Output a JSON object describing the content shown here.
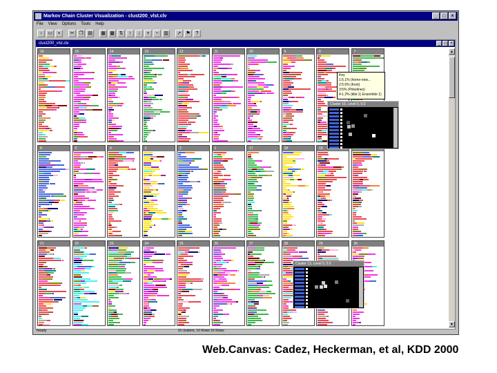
{
  "window": {
    "title": "Markov Chain Cluster Visualization - clust200_vlst.clv",
    "minimize": "_",
    "maximize": "□",
    "close": "×"
  },
  "menu": [
    "File",
    "View",
    "Options",
    "Tools",
    "Help"
  ],
  "mdi": {
    "title": "clust200_vlst.clv"
  },
  "tooltip": {
    "lines": [
      "Key",
      "1:5.1% (home-new...",
      "2:5.6% (front)",
      "3:5% (Pirkelines)",
      "4:1.2% (title:1) Ensemble 1)"
    ]
  },
  "popups": [
    {
      "title": "Cluster 16, Level 0, 0.0"
    },
    {
      "title": "Cluster 13, Level 0, 0.0"
    }
  ],
  "status": {
    "left": "Ready",
    "right": "16 clusters, 10 Rows  16 Rows"
  },
  "caption": "Web.Canvas: Cadez, Heckerman, et al, KDD 2000",
  "colors": {
    "title_blue": "#000080",
    "palette": [
      "#e8464e",
      "#3cb44b",
      "#f032e6",
      "#4363d8",
      "#46f0f0",
      "#f58231",
      "#ffe119",
      "#911eb4",
      "#9a6324",
      "#a9a9a9",
      "#808000",
      "#ffb3d9",
      "#008080",
      "#800000",
      "#000075"
    ]
  },
  "clusters": [
    {
      "label": "16",
      "dominant": "#e8464e"
    },
    {
      "label": "15",
      "dominant": "#f032e6"
    },
    {
      "label": "14",
      "dominant": "#f032e6"
    },
    {
      "label": "13",
      "dominant": "#3cb44b"
    },
    {
      "label": "12",
      "dominant": "#e8464e"
    },
    {
      "label": "11",
      "dominant": "#f032e6"
    },
    {
      "label": "10",
      "dominant": "#f032e6"
    },
    {
      "label": "9",
      "dominant": "#e8464e"
    },
    {
      "label": "8",
      "dominant": "#e8464e"
    },
    {
      "label": "7",
      "dominant": "#3cb44b"
    },
    {
      "label": "6",
      "dominant": "#4363d8"
    },
    {
      "label": "5",
      "dominant": "#f032e6"
    },
    {
      "label": "4",
      "dominant": "#e8464e"
    },
    {
      "label": "3",
      "dominant": "#ffe119"
    },
    {
      "label": "2",
      "dominant": "#4363d8"
    },
    {
      "label": "1",
      "dominant": "#e8464e"
    },
    {
      "label": "17",
      "dominant": "#3cb44b"
    },
    {
      "label": "18",
      "dominant": "#ffe119"
    },
    {
      "label": "19",
      "dominant": "#e8464e"
    },
    {
      "label": "20",
      "dominant": "#e8464e"
    },
    {
      "label": "21",
      "dominant": "#e8464e"
    },
    {
      "label": "22",
      "dominant": "#46f0f0"
    },
    {
      "label": "23",
      "dominant": "#3cb44b"
    },
    {
      "label": "24",
      "dominant": "#f032e6"
    },
    {
      "label": "25",
      "dominant": "#e8464e"
    },
    {
      "label": "26",
      "dominant": "#f032e6"
    },
    {
      "label": "27",
      "dominant": "#3cb44b"
    },
    {
      "label": "28",
      "dominant": "#e8464e"
    },
    {
      "label": "29",
      "dominant": "#e8464e"
    },
    {
      "label": "30",
      "dominant": "#f032e6"
    }
  ]
}
